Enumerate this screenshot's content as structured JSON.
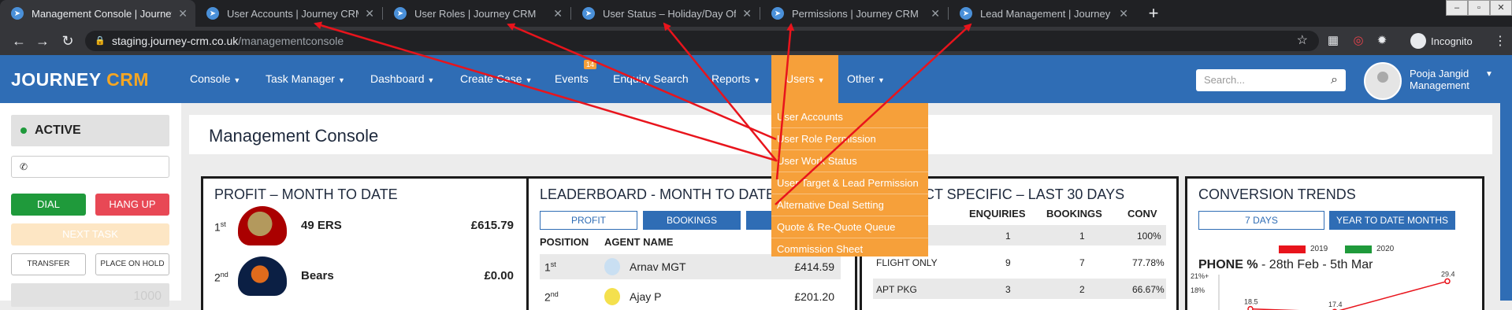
{
  "browser": {
    "tabs": [
      {
        "title": "Management Console | Journey CRM",
        "active": true
      },
      {
        "title": "User Accounts | Journey CRM",
        "active": false
      },
      {
        "title": "User Roles | Journey CRM",
        "active": false
      },
      {
        "title": "User Status – Holiday/Day Off | Journey CRM",
        "active": false
      },
      {
        "title": "Permissions | Journey CRM",
        "active": false
      },
      {
        "title": "Lead Management | Journey CRM",
        "active": false
      }
    ],
    "close_glyph": "✕",
    "new_tab_glyph": "+",
    "url_host": "staging.journey-crm.co.uk",
    "url_path": "/managementconsole",
    "incognito_label": "Incognito",
    "extension_badge": "3"
  },
  "app": {
    "logo_main": "JOURNEY ",
    "logo_accent": "CRM",
    "nav": [
      {
        "label": "Console",
        "caret": true
      },
      {
        "label": "Task Manager",
        "caret": true
      },
      {
        "label": "Dashboard",
        "caret": true
      },
      {
        "label": "Create Case",
        "caret": true
      },
      {
        "label": "Events",
        "caret": false
      },
      {
        "label": "Enquiry Search",
        "caret": false
      },
      {
        "label": "Reports",
        "caret": true
      },
      {
        "label": "Users",
        "caret": true
      },
      {
        "label": "Other",
        "caret": true
      }
    ],
    "events_badge": "14",
    "search_placeholder": "Search...",
    "user_name": "Pooja Jangid",
    "user_role": "Management"
  },
  "users_menu": [
    "User Accounts",
    "User Role Permission",
    "User Work Status",
    "User Target & Lead Permission",
    "Alternative Deal Setting",
    "Quote & Re-Quote Queue",
    "Commission Sheet"
  ],
  "sidebar": {
    "status": "ACTIVE",
    "dial": "DIAL",
    "hang_up": "HANG UP",
    "next_task": "NEXT TASK",
    "transfer": "TRANSFER",
    "place_on_hold": "PLACE ON HOLD",
    "footer_value": "1000"
  },
  "page_title": "Management Console",
  "profit_panel": {
    "title": "PROFIT – MONTH TO DATE",
    "rows": [
      {
        "pos": "1",
        "suffix": "st",
        "team": "49 ERS",
        "amount": "£615.79"
      },
      {
        "pos": "2",
        "suffix": "nd",
        "team": "Bears",
        "amount": "£0.00"
      }
    ]
  },
  "leaderboard": {
    "title": "LEADERBOARD - MONTH TO DATE",
    "tabs": [
      "PROFIT",
      "BOOKINGS",
      "B"
    ],
    "headers": [
      "POSITION",
      "AGENT NAME",
      "T"
    ],
    "rows": [
      {
        "pos": "1",
        "suffix": "st",
        "agent": "Arnav MGT",
        "amount": "£414.59"
      },
      {
        "pos": "2",
        "suffix": "nd",
        "agent": "Ajay P",
        "amount": "£201.20"
      }
    ]
  },
  "product_panel": {
    "title": "PRODUCT SPECIFIC – LAST 30 DAYS",
    "headers": [
      "ENQUIRIES",
      "BOOKINGS",
      "CONV"
    ],
    "rows": [
      {
        "name": "",
        "enq": "1",
        "book": "1",
        "conv": "100%"
      },
      {
        "name": "FLIGHT ONLY",
        "enq": "9",
        "book": "7",
        "conv": "77.78%"
      },
      {
        "name": "APT PKG",
        "enq": "3",
        "book": "2",
        "conv": "66.67%"
      }
    ]
  },
  "conversion": {
    "title": "CONVERSION TRENDS",
    "tabs": [
      "7 DAYS",
      "YEAR TO DATE MONTHS"
    ],
    "phone_label": "PHONE %",
    "phone_range": " - 28th Feb - 5th Mar",
    "colors": {
      "2019": "#e8141c",
      "2020": "#1f9a3b"
    }
  },
  "chart_data": {
    "type": "line",
    "title": "PHONE % - 28th Feb - 5th Mar",
    "series": [
      {
        "name": "2019",
        "values": [
          18.5,
          17.4,
          29.4
        ]
      },
      {
        "name": "2020",
        "values": []
      }
    ],
    "ytick_labels": [
      "21%+",
      "18%"
    ],
    "data_labels": [
      "18.5",
      "17.4",
      "29.4"
    ]
  }
}
